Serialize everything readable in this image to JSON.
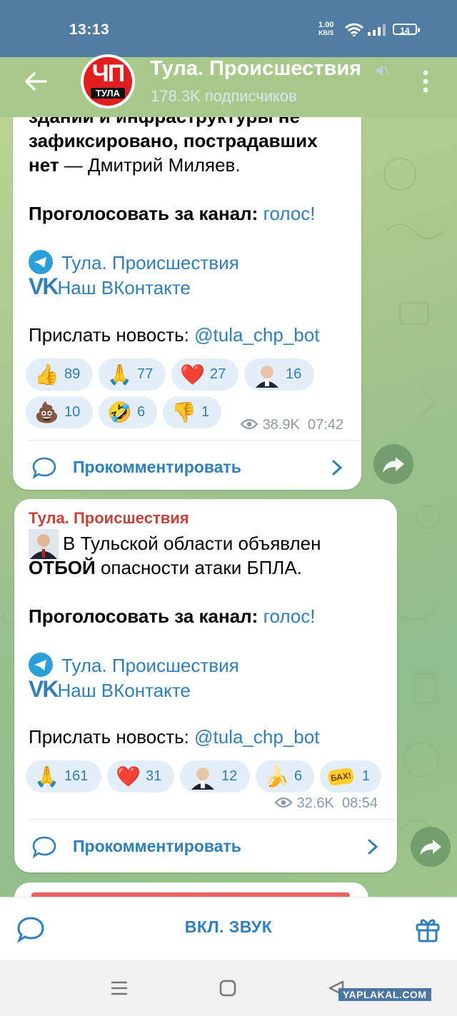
{
  "status": {
    "time": "13:13",
    "speed_value": "1.00",
    "speed_unit": "KB/S",
    "battery": "14"
  },
  "header": {
    "title": "Тула. Происшествия",
    "subscribers": "178.3K подписчиков",
    "avatar_text_top": "ЧП",
    "avatar_text_bottom": "ТУЛА"
  },
  "post1": {
    "line_a": "зданий и инфраструктуры не",
    "line_b": "зафиксировано, пострадавших",
    "line_c_bold": "нет",
    "line_c_rest": " — Дмитрий Миляев.",
    "vote_label": "Проголосовать за канал:",
    "vote_link": "голос!",
    "tg_link": "Тула. Происшествия",
    "vk_logo": "VK",
    "vk_link": "Наш ВКонтакте",
    "send_label": "Прислать новость:",
    "send_link": "@tula_chp_bot",
    "reactions": [
      {
        "emoji": "👍",
        "count": "89"
      },
      {
        "emoji": "🙏",
        "count": "77"
      },
      {
        "emoji": "❤️",
        "count": "27"
      },
      {
        "emoji": "putin-sticker",
        "count": "16"
      },
      {
        "emoji": "💩",
        "count": "10"
      },
      {
        "emoji": "🤣",
        "count": "6"
      },
      {
        "emoji": "👎",
        "count": "1"
      }
    ],
    "views": "38.9K",
    "time": "07:42",
    "comment_label": "Прокомментировать"
  },
  "post2": {
    "author": "Тула. Происшествия",
    "line_a": "В Тульской области объявлен",
    "line_b_bold": "ОТБОЙ",
    "line_b_rest": " опасности атаки БПЛА.",
    "vote_label": "Проголосовать за канал:",
    "vote_link": "голос!",
    "tg_link": "Тула. Происшествия",
    "vk_logo": "VK",
    "vk_link": "Наш ВКонтакте",
    "send_label": "Прислать новость:",
    "send_link": "@tula_chp_bot",
    "reactions": [
      {
        "emoji": "🙏",
        "count": "161"
      },
      {
        "emoji": "❤️",
        "count": "31"
      },
      {
        "emoji": "putin-sticker",
        "count": "12"
      },
      {
        "emoji": "🍌",
        "count": "6"
      },
      {
        "emoji": "БАХ!",
        "count": "1"
      }
    ],
    "views": "32.6K",
    "time": "08:54",
    "comment_label": "Прокомментировать"
  },
  "bottom": {
    "sound_button": "ВКЛ. ЗВУК"
  },
  "watermark": "YAPLAKAL.COM",
  "colors": {
    "header": "#517da2",
    "link": "#2e7fbd",
    "author": "#c8423a"
  }
}
